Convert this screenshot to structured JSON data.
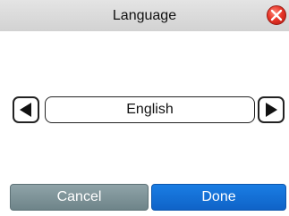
{
  "dialog": {
    "title": "Language",
    "close_icon": "close-icon"
  },
  "language_picker": {
    "selected": "English",
    "prev_icon": "triangle-left-icon",
    "next_icon": "triangle-right-icon"
  },
  "buttons": {
    "cancel_label": "Cancel",
    "done_label": "Done"
  },
  "colors": {
    "titlebar": "#d8d8d8",
    "close": "#e8372a",
    "cancel": "#7f9499",
    "done": "#1570d6"
  }
}
